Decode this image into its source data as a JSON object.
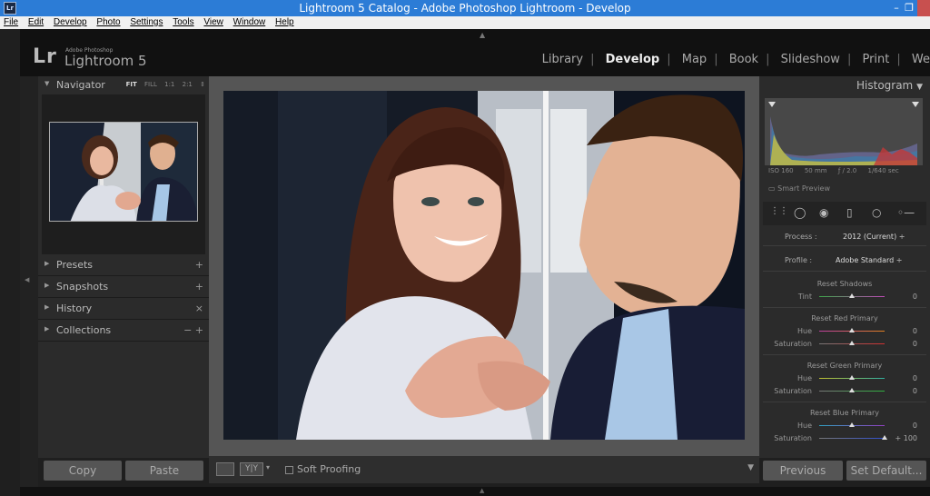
{
  "window": {
    "title": "Lightroom 5 Catalog - Adobe Photoshop Lightroom - Develop",
    "app_icon": "Lr",
    "minimize": "–",
    "restore": "❐"
  },
  "menu": [
    "File",
    "Edit",
    "Develop",
    "Photo",
    "Settings",
    "Tools",
    "View",
    "Window",
    "Help"
  ],
  "identity": {
    "logo": "Lr",
    "sub": "Adobe Photoshop",
    "name": "Lightroom 5"
  },
  "modules": [
    "Library",
    "Develop",
    "Map",
    "Book",
    "Slideshow",
    "Print",
    "We"
  ],
  "active_module": "Develop",
  "navigator": {
    "label": "Navigator",
    "zoom": [
      "FIT",
      "FILL",
      "1:1",
      "2:1"
    ],
    "zoom_selected": "FIT",
    "zoom_more": "⇕"
  },
  "left_panels": [
    {
      "label": "Presets",
      "action": "+"
    },
    {
      "label": "Snapshots",
      "action": "+"
    },
    {
      "label": "History",
      "action": "×"
    },
    {
      "label": "Collections",
      "action": "− +"
    }
  ],
  "left_buttons": {
    "copy": "Copy",
    "paste": "Paste"
  },
  "toolbar": {
    "soft_proofing": "Soft Proofing",
    "yy": "Y|Y",
    "dropdown": "▾"
  },
  "histogram": {
    "label": "Histogram",
    "exif": {
      "iso": "ISO 160",
      "focal": "50 mm",
      "aperture": "ƒ / 2.0",
      "shutter": "1/640 sec"
    },
    "smart_preview": "Smart Preview"
  },
  "camera_calibration": {
    "process_label": "Process :",
    "process_value": "2012 (Current) ÷",
    "profile_label": "Profile :",
    "profile_value": "Adobe Standard ÷",
    "sections": [
      {
        "title": "Reset Shadows",
        "sliders": [
          {
            "label": "Tint",
            "value": "0",
            "level": 0.5,
            "track": "#3da84a,#c04ab8"
          }
        ]
      },
      {
        "title": "Reset Red Primary",
        "sliders": [
          {
            "label": "Hue",
            "value": "0",
            "level": 0.5,
            "track": "#c040a0,#e08020"
          },
          {
            "label": "Saturation",
            "value": "0",
            "level": 0.5,
            "track": "#777,#d03030"
          }
        ]
      },
      {
        "title": "Reset Green Primary",
        "sliders": [
          {
            "label": "Hue",
            "value": "0",
            "level": 0.5,
            "track": "#c0c030,#30b0a0"
          },
          {
            "label": "Saturation",
            "value": "0",
            "level": 0.5,
            "track": "#777,#30b040"
          }
        ]
      },
      {
        "title": "Reset Blue Primary",
        "sliders": [
          {
            "label": "Hue",
            "value": "0",
            "level": 0.5,
            "track": "#30a0c0,#9040c0"
          },
          {
            "label": "Saturation",
            "value": "+ 100",
            "level": 1.0,
            "track": "#777,#3050d0"
          }
        ]
      }
    ]
  },
  "right_buttons": {
    "previous": "Previous",
    "set_default": "Set Default..."
  },
  "colors": {
    "titlebar": "#2c7cd6",
    "panel": "#2b2b2b",
    "photo_bg": "#555555"
  }
}
